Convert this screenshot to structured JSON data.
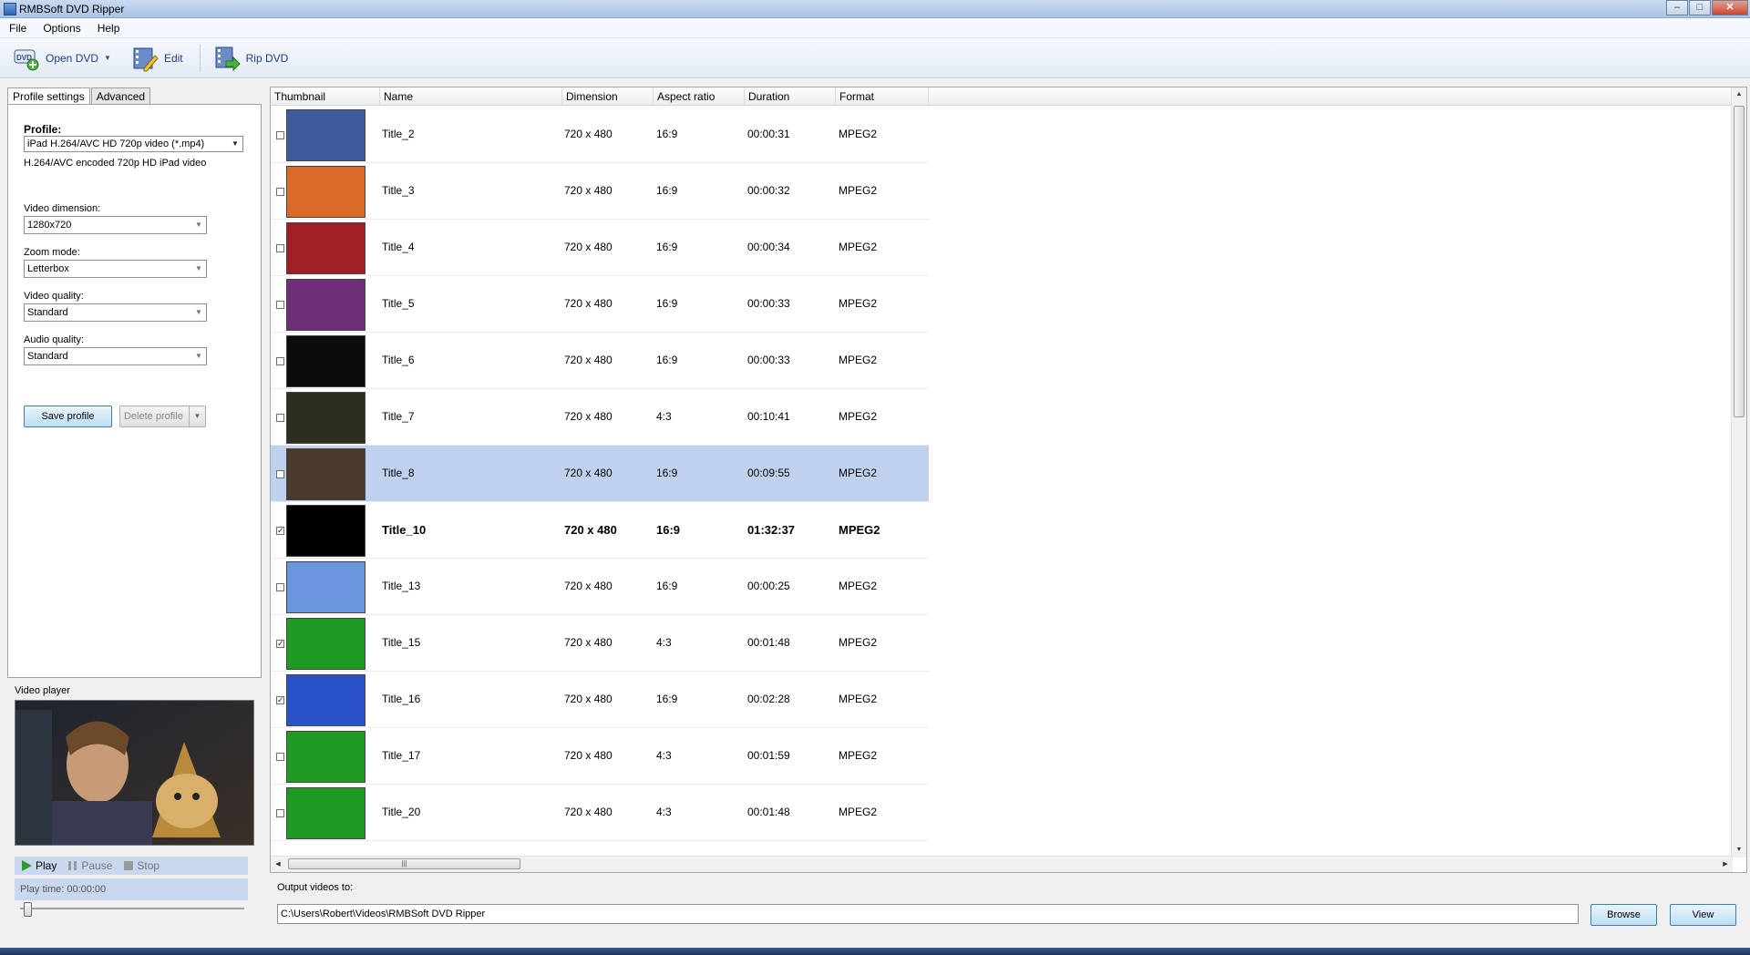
{
  "window": {
    "title": "RMBSoft DVD Ripper"
  },
  "menu": [
    "File",
    "Options",
    "Help"
  ],
  "toolbar": {
    "open_dvd": "Open DVD",
    "edit": "Edit",
    "rip_dvd": "Rip DVD"
  },
  "tabs": [
    "Profile settings",
    "Advanced"
  ],
  "profile": {
    "label": "Profile:",
    "value": "iPad H.264/AVC HD 720p video (*.mp4)",
    "description": "H.264/AVC encoded 720p HD iPad video"
  },
  "settings": {
    "video_dimension": {
      "label": "Video dimension:",
      "value": "1280x720"
    },
    "zoom_mode": {
      "label": "Zoom mode:",
      "value": "Letterbox"
    },
    "video_quality": {
      "label": "Video quality:",
      "value": "Standard"
    },
    "audio_quality": {
      "label": "Audio quality:",
      "value": "Standard"
    }
  },
  "buttons": {
    "save_profile": "Save profile",
    "delete_profile": "Delete profile",
    "browse": "Browse",
    "view": "View"
  },
  "player": {
    "label": "Video player",
    "play": "Play",
    "pause": "Pause",
    "stop": "Stop",
    "time": "Play time: 00:00:00",
    "progress": 0
  },
  "table": {
    "columns": [
      "Thumbnail",
      "Name",
      "Dimension",
      "Aspect ratio",
      "Duration",
      "Format"
    ],
    "rows": [
      {
        "name": "Title_2",
        "dimension": "720 x 480",
        "aspect": "16:9",
        "duration": "00:00:31",
        "format": "MPEG2",
        "checked": false,
        "selected": false,
        "bold": false,
        "thumb": "#3d5a9e"
      },
      {
        "name": "Title_3",
        "dimension": "720 x 480",
        "aspect": "16:9",
        "duration": "00:00:32",
        "format": "MPEG2",
        "checked": false,
        "selected": false,
        "bold": false,
        "thumb": "#d96a2a"
      },
      {
        "name": "Title_4",
        "dimension": "720 x 480",
        "aspect": "16:9",
        "duration": "00:00:34",
        "format": "MPEG2",
        "checked": false,
        "selected": false,
        "bold": false,
        "thumb": "#a01e24"
      },
      {
        "name": "Title_5",
        "dimension": "720 x 480",
        "aspect": "16:9",
        "duration": "00:00:33",
        "format": "MPEG2",
        "checked": false,
        "selected": false,
        "bold": false,
        "thumb": "#6e2f78"
      },
      {
        "name": "Title_6",
        "dimension": "720 x 480",
        "aspect": "16:9",
        "duration": "00:00:33",
        "format": "MPEG2",
        "checked": false,
        "selected": false,
        "bold": false,
        "thumb": "#0c0c0c"
      },
      {
        "name": "Title_7",
        "dimension": "720 x 480",
        "aspect": "4:3",
        "duration": "00:10:41",
        "format": "MPEG2",
        "checked": false,
        "selected": false,
        "bold": false,
        "thumb": "#2a2e1e"
      },
      {
        "name": "Title_8",
        "dimension": "720 x 480",
        "aspect": "16:9",
        "duration": "00:09:55",
        "format": "MPEG2",
        "checked": false,
        "selected": true,
        "bold": false,
        "thumb": "#4a3a2c"
      },
      {
        "name": "Title_10",
        "dimension": "720 x 480",
        "aspect": "16:9",
        "duration": "01:32:37",
        "format": "MPEG2",
        "checked": true,
        "selected": false,
        "bold": true,
        "thumb": "#000000"
      },
      {
        "name": "Title_13",
        "dimension": "720 x 480",
        "aspect": "16:9",
        "duration": "00:00:25",
        "format": "MPEG2",
        "checked": false,
        "selected": false,
        "bold": false,
        "thumb": "#6a96e0"
      },
      {
        "name": "Title_15",
        "dimension": "720 x 480",
        "aspect": "4:3",
        "duration": "00:01:48",
        "format": "MPEG2",
        "checked": true,
        "selected": false,
        "bold": false,
        "thumb": "#1e9a22"
      },
      {
        "name": "Title_16",
        "dimension": "720 x 480",
        "aspect": "16:9",
        "duration": "00:02:28",
        "format": "MPEG2",
        "checked": true,
        "selected": false,
        "bold": false,
        "thumb": "#2a52c8"
      },
      {
        "name": "Title_17",
        "dimension": "720 x 480",
        "aspect": "4:3",
        "duration": "00:01:59",
        "format": "MPEG2",
        "checked": false,
        "selected": false,
        "bold": false,
        "thumb": "#1e9a22"
      },
      {
        "name": "Title_20",
        "dimension": "720 x 480",
        "aspect": "4:3",
        "duration": "00:01:48",
        "format": "MPEG2",
        "checked": false,
        "selected": false,
        "bold": false,
        "thumb": "#1e9a22"
      }
    ]
  },
  "output": {
    "label": "Output videos to:",
    "path": "C:\\Users\\Robert\\Videos\\RMBSoft DVD Ripper"
  }
}
